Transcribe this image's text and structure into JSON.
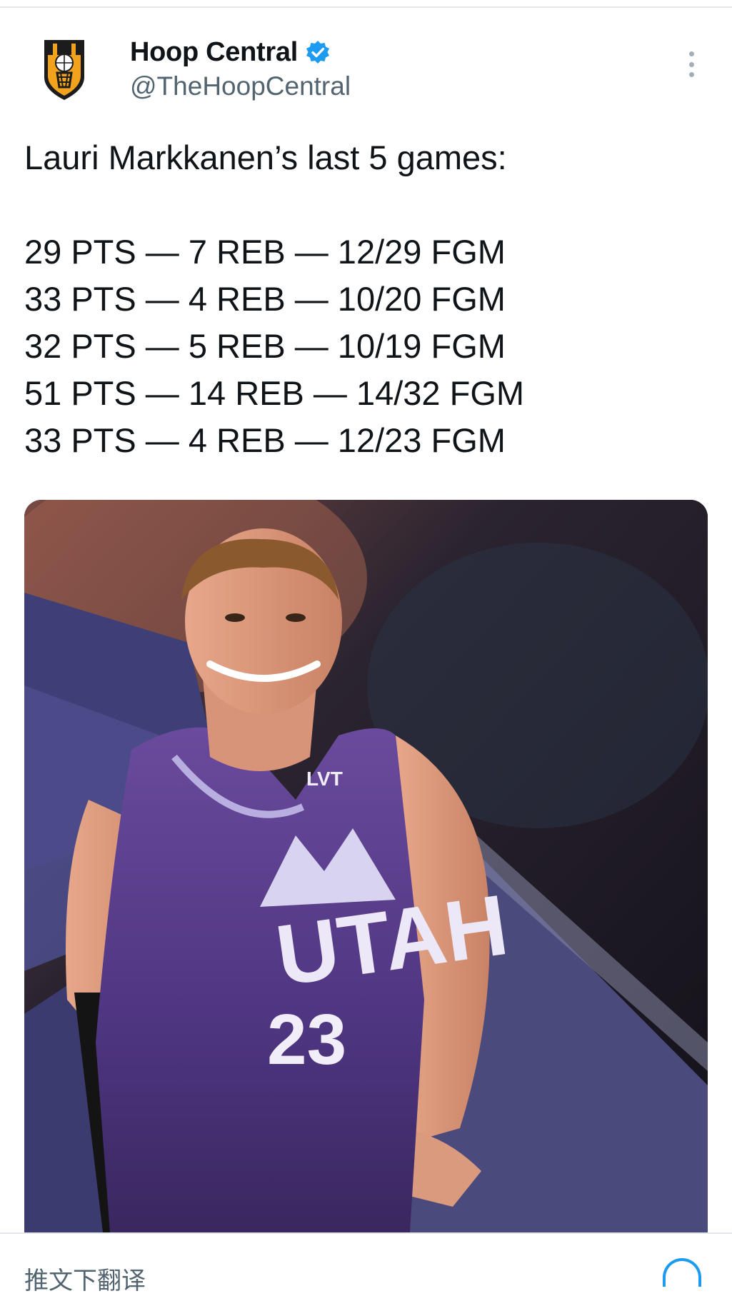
{
  "account": {
    "display_name": "Hoop Central",
    "handle": "@TheHoopCentral",
    "verified": true,
    "verified_color": "#1d9bf0",
    "avatar_icon": "shield-basketball-logo"
  },
  "tweet": {
    "intro": "Lauri Markkanen’s last 5 games:",
    "games": [
      "29 PTS — 7 REB — 12/29 FGM",
      "33 PTS — 4 REB — 10/20 FGM",
      "32 PTS — 5 REB — 10/19 FGM",
      "51 PTS — 14 REB — 14/32 FGM",
      "33 PTS — 4 REB — 12/23 FGM"
    ]
  },
  "media": {
    "jersey_team": "UTAH",
    "jersey_number": "23",
    "jersey_patch": "LVT"
  },
  "footer": {
    "partial_text": "推文下翻译"
  },
  "colors": {
    "text": "#0f1419",
    "secondary": "#536471",
    "accent": "#1d9bf0",
    "jersey": "#5b3c8c"
  }
}
